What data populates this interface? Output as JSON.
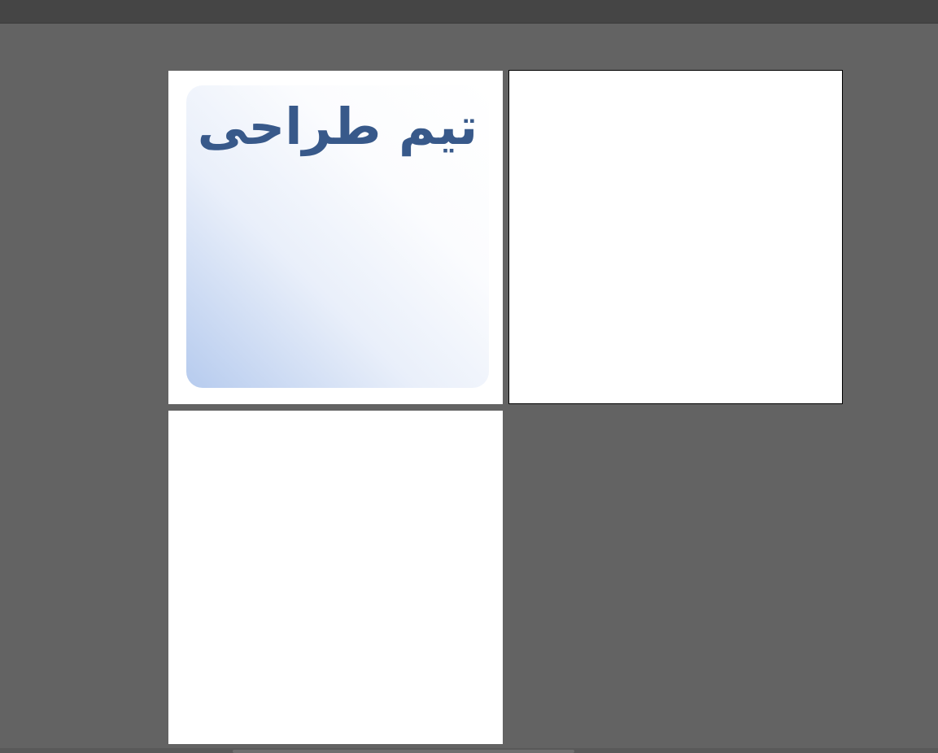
{
  "canvas": {
    "background": "#636363",
    "artboards": [
      {
        "card": {
          "title": "تیم طراحی",
          "title_color": "#38598a",
          "gradient_colors": [
            "#ffffff",
            "#b6cbee"
          ]
        }
      },
      {},
      {}
    ]
  }
}
